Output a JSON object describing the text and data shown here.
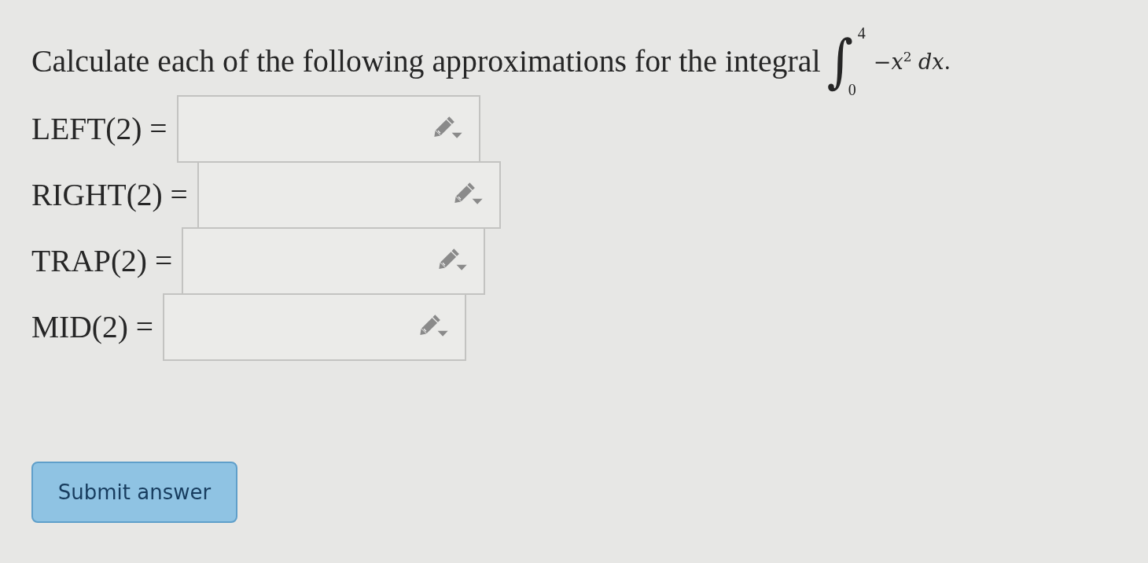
{
  "question": {
    "text": "Calculate each of the following approximations for the integral",
    "integral": {
      "symbol": "∫",
      "upper": "4",
      "lower": "0",
      "integrand": "−*x*$^{2}$ *dx*."
    }
  },
  "answers": [
    {
      "label": "LEFT(2) ="
    },
    {
      "label": "RIGHT(2) ="
    },
    {
      "label": "TRAP(2) ="
    },
    {
      "label": "MID(2) ="
    }
  ],
  "submit_button": {
    "label": "Submit answer"
  }
}
